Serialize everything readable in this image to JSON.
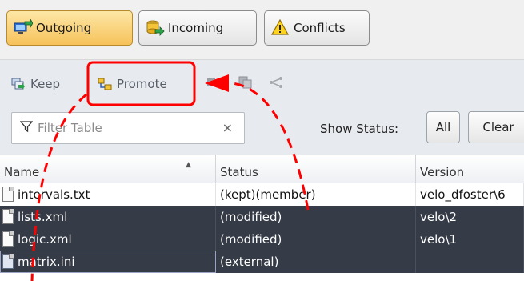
{
  "tabs": [
    {
      "label": "Outgoing",
      "icon": "outgoing-icon",
      "active": true
    },
    {
      "label": "Incoming",
      "icon": "incoming-icon",
      "active": false
    },
    {
      "label": "Conflicts",
      "icon": "warning-icon",
      "active": false
    }
  ],
  "actions": {
    "keep_label": "Keep",
    "promote_label": "Promote"
  },
  "filter": {
    "placeholder": "Filter Table",
    "clear_symbol": "×",
    "show_status_label": "Show Status:",
    "all_label": "All",
    "clear_label": "Clear"
  },
  "table": {
    "headers": {
      "name": "Name",
      "status": "Status",
      "version": "Version"
    },
    "rows": [
      {
        "name": "intervals.txt",
        "status": "(kept)(member)",
        "version": "velo_dfoster\\6",
        "selected": false
      },
      {
        "name": "lists.xml",
        "status": "(modified)",
        "version": "velo\\2",
        "selected": true
      },
      {
        "name": "logic.xml",
        "status": "(modified)",
        "version": "velo\\1",
        "selected": true
      },
      {
        "name": "matrix.ini",
        "status": "(external)",
        "version": "",
        "selected": true
      }
    ]
  },
  "colors": {
    "active_tab": "#f6c25a",
    "selection": "#353b47",
    "annotation": "#ff0000"
  }
}
